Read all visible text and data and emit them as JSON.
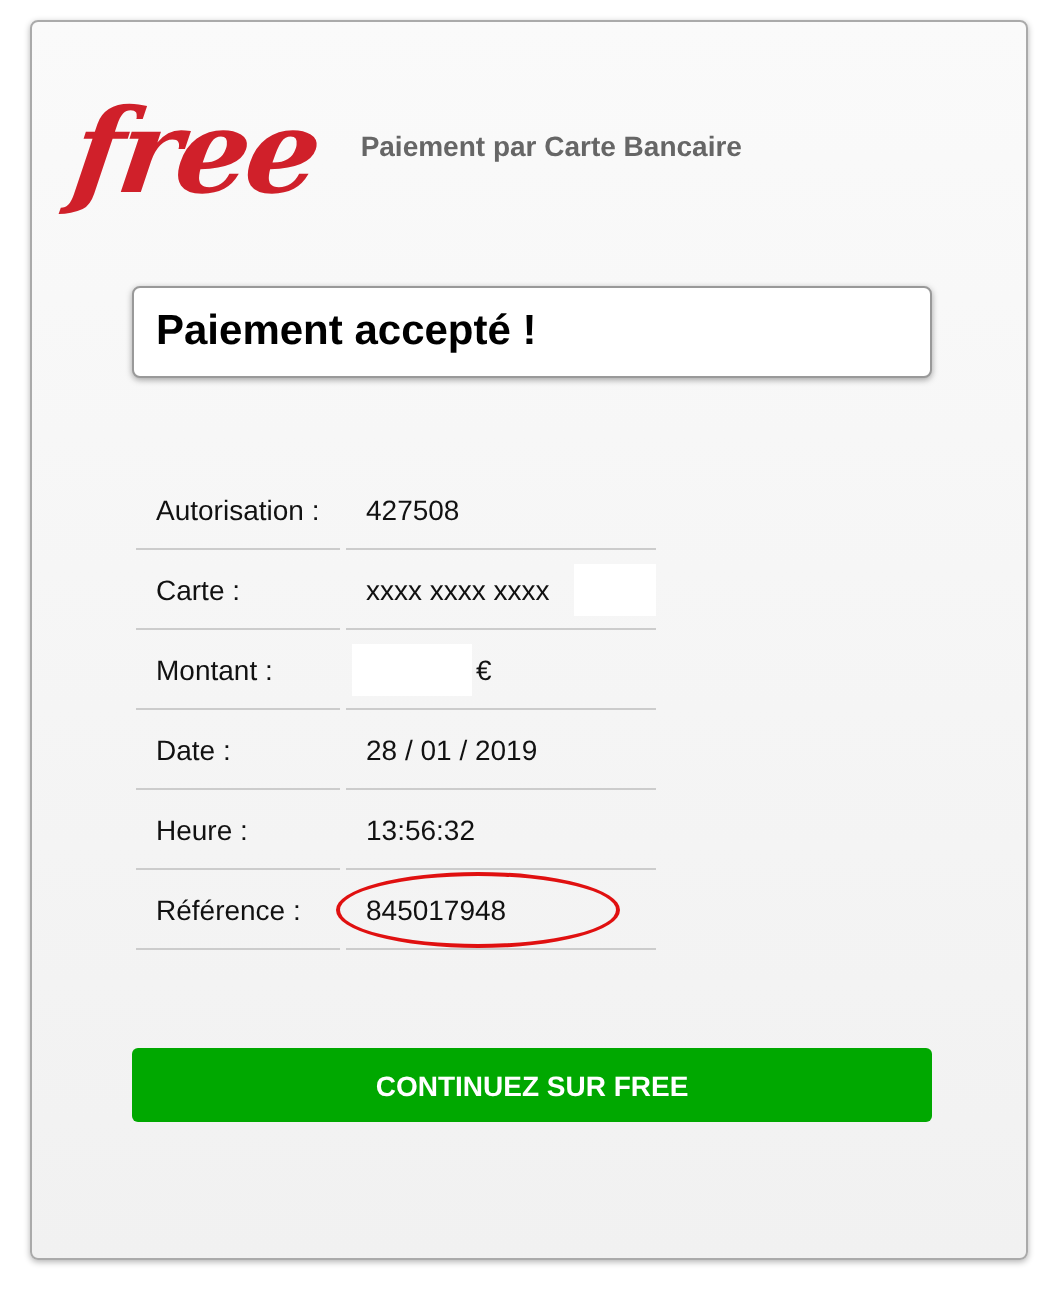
{
  "header": {
    "logo": "free",
    "subtitle": "Paiement par Carte Bancaire"
  },
  "status": {
    "title": "Paiement accepté !"
  },
  "details": [
    {
      "label": "Autorisation :",
      "value": "427508",
      "masked_before": false,
      "masked_after": false,
      "highlighted": false
    },
    {
      "label": "Carte :",
      "value": "xxxx xxxx xxxx",
      "masked_before": false,
      "masked_after": true,
      "highlighted": false
    },
    {
      "label": "Montant :",
      "value": "€",
      "masked_before": true,
      "masked_after": false,
      "highlighted": false
    },
    {
      "label": "Date :",
      "value": "28 / 01 / 2019",
      "masked_before": false,
      "masked_after": false,
      "highlighted": false
    },
    {
      "label": "Heure :",
      "value": "13:56:32",
      "masked_before": false,
      "masked_after": false,
      "highlighted": false
    },
    {
      "label": "Référence :",
      "value": "845017948",
      "masked_before": false,
      "masked_after": false,
      "highlighted": true
    }
  ],
  "button": {
    "label": "CONTINUEZ SUR FREE"
  }
}
